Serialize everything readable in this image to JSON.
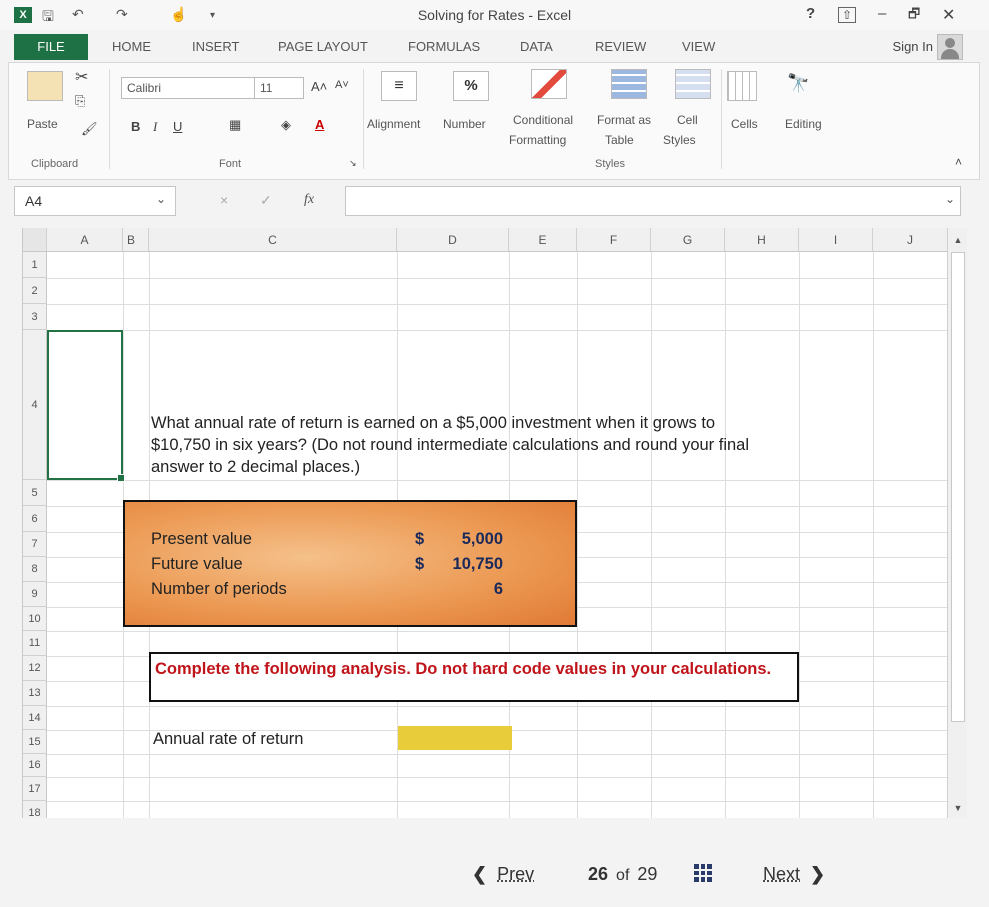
{
  "window": {
    "title": "Solving for Rates - Excel",
    "help": "?",
    "minimize": "–",
    "restore": "🗗",
    "close": "✕"
  },
  "tabs": [
    "HOME",
    "INSERT",
    "PAGE LAYOUT",
    "FORMULAS",
    "DATA",
    "REVIEW",
    "VIEW"
  ],
  "file_tab": "FILE",
  "sign_in": "Sign In",
  "ribbon": {
    "paste": "Paste",
    "font_name": "Calibri",
    "font_size": "11",
    "bold": "B",
    "italic": "I",
    "underline": "U",
    "alignment": "Alignment",
    "number": "Number",
    "percent": "%",
    "conditional_formatting": [
      "Conditional",
      "Formatting"
    ],
    "format_as_table": [
      "Format as",
      "Table"
    ],
    "cell_styles": [
      "Cell",
      "Styles"
    ],
    "cells": "Cells",
    "editing": "Editing",
    "groups": {
      "clipboard": "Clipboard",
      "font": "Font",
      "styles": "Styles"
    }
  },
  "formula_bar": {
    "name_box": "A4",
    "fx": "fx",
    "cancel": "×",
    "enter": "✓",
    "value": ""
  },
  "columns": [
    "A",
    "B",
    "C",
    "D",
    "E",
    "F",
    "G",
    "H",
    "I",
    "J"
  ],
  "rows": [
    "1",
    "2",
    "3",
    "4",
    "5",
    "6",
    "7",
    "8",
    "9",
    "10",
    "11",
    "12",
    "13",
    "14",
    "15",
    "16",
    "17",
    "18"
  ],
  "sheet": {
    "question": "What annual rate of return is earned on a $5,000 investment when it grows to $10,750 in six years? (Do not round intermediate calculations and round your final answer to 2 decimal places.)",
    "inputs": [
      {
        "label": "Present value",
        "currency": "$",
        "value": "5,000"
      },
      {
        "label": "Future value",
        "currency": "$",
        "value": "10,750"
      },
      {
        "label": "Number of periods",
        "currency": "",
        "value": "6"
      }
    ],
    "instruction": "Complete the following analysis. Do not hard code values in your calculations.",
    "result_label": "Annual rate of return",
    "result_value": ""
  },
  "nav": {
    "prev": "Prev",
    "current": "26",
    "of": "of",
    "total": "29",
    "next": "Next"
  }
}
